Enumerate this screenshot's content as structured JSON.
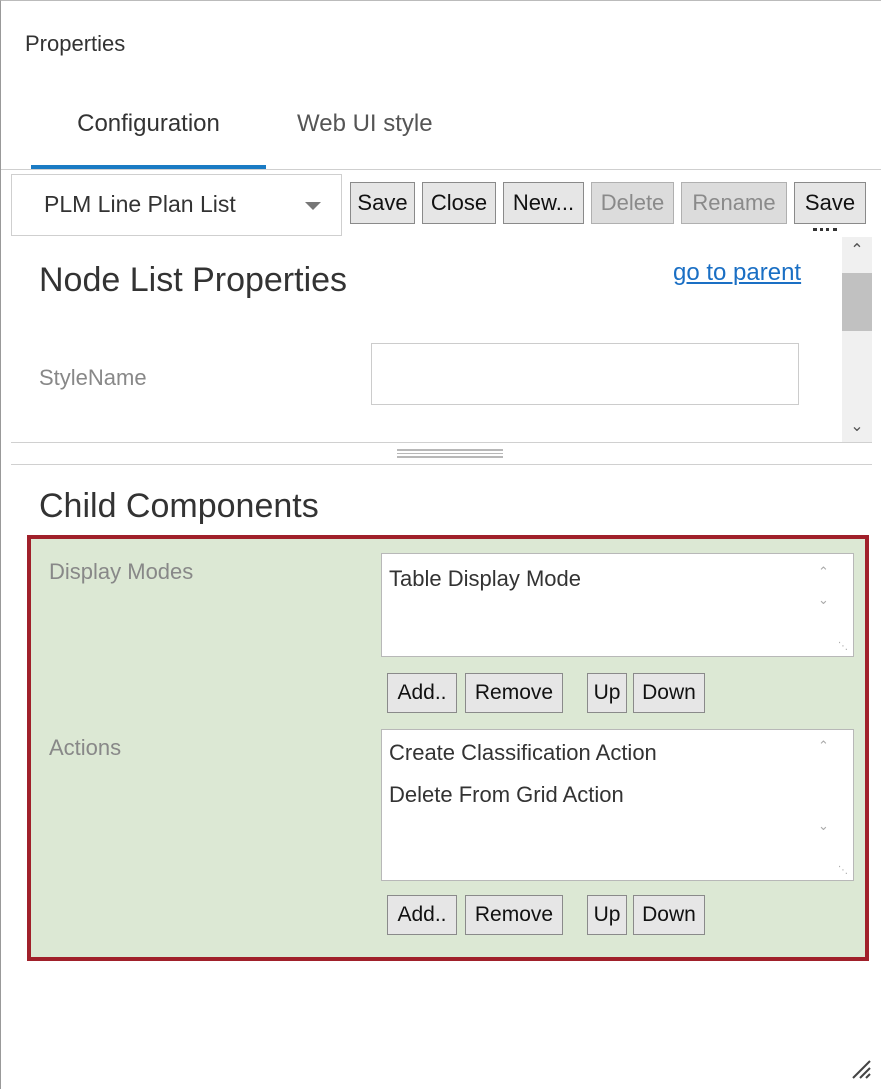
{
  "panel": {
    "title": "Properties"
  },
  "tabs": [
    {
      "label": "Configuration",
      "active": true
    },
    {
      "label": "Web UI style",
      "active": false
    }
  ],
  "toolbar": {
    "select_value": "PLM Line Plan List",
    "buttons": {
      "save": "Save",
      "close": "Close",
      "new": "New...",
      "delete": "Delete",
      "rename": "Rename",
      "save2": "Save"
    }
  },
  "properties": {
    "heading": "Node List Properties",
    "go_to_parent": "go to parent",
    "stylename_label": "StyleName",
    "stylename_value": ""
  },
  "child_components": {
    "heading": "Child Components",
    "display_modes": {
      "label": "Display Modes",
      "items": [
        "Table Display Mode"
      ],
      "buttons": {
        "add": "Add..",
        "remove": "Remove",
        "up": "Up",
        "down": "Down"
      }
    },
    "actions": {
      "label": "Actions",
      "items": [
        "Create Classification Action",
        "Delete From Grid Action"
      ],
      "buttons": {
        "add": "Add..",
        "remove": "Remove",
        "up": "Up",
        "down": "Down"
      }
    }
  },
  "colors": {
    "accent": "#1a7bc4",
    "highlight_border": "#a0202a",
    "highlight_fill": "#dce8d4",
    "link": "#1a6fc4"
  }
}
